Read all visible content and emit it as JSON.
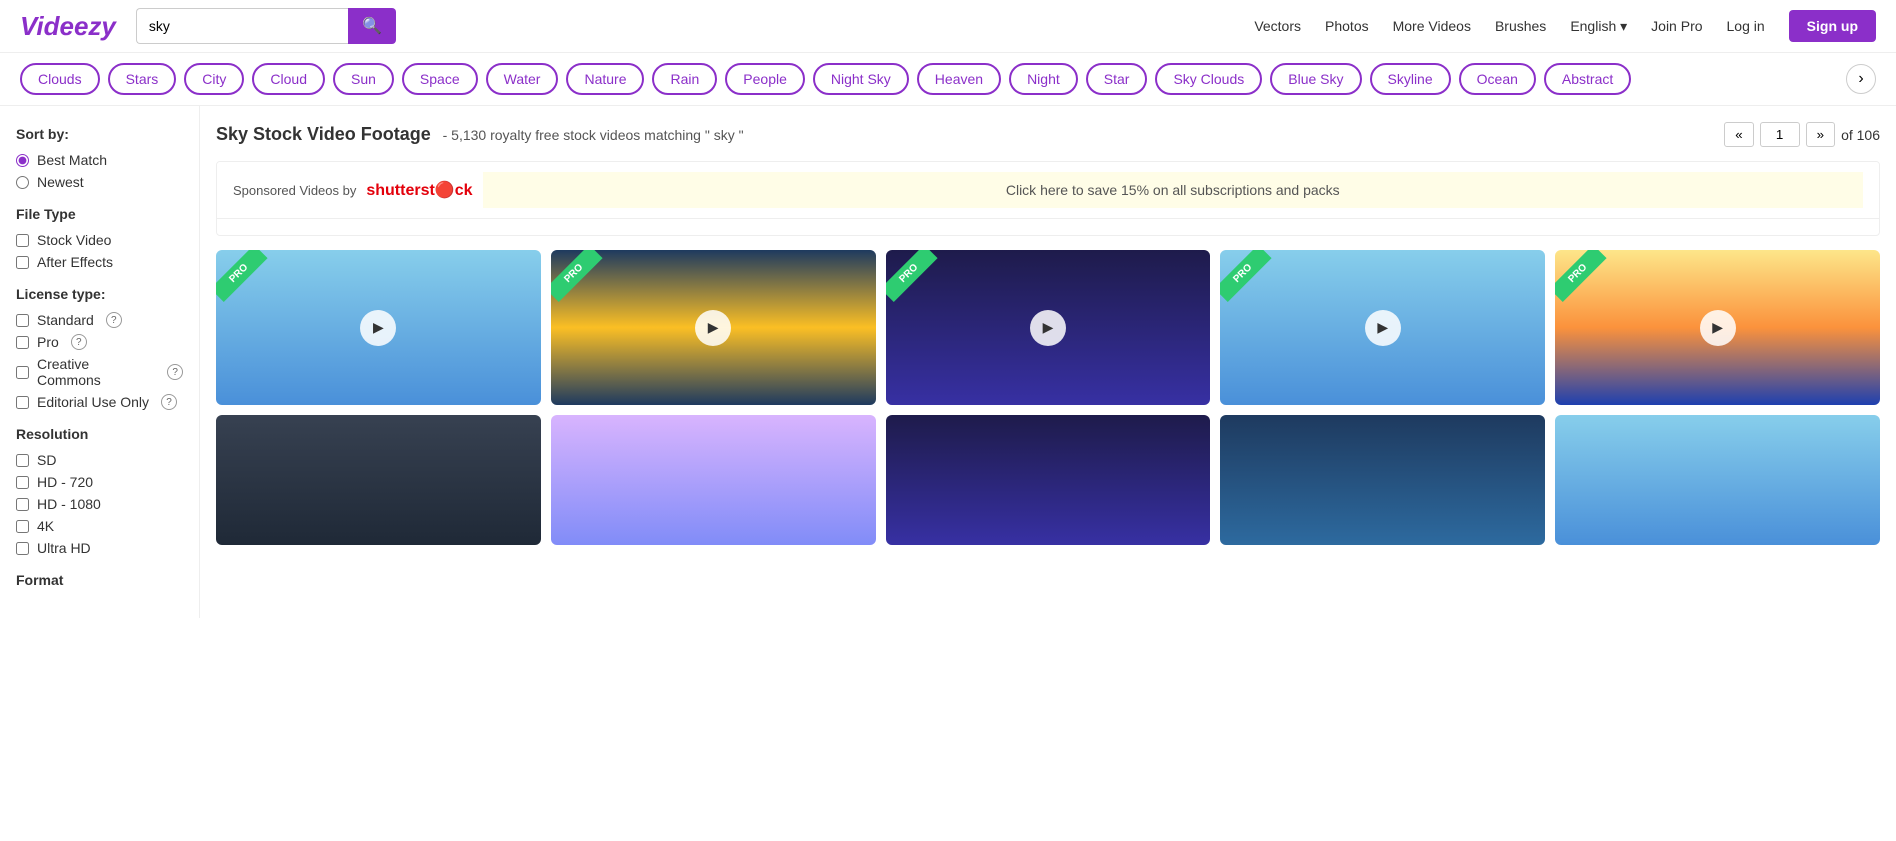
{
  "header": {
    "logo": "Videezy",
    "search": {
      "value": "sky",
      "placeholder": "sky"
    },
    "nav": {
      "vectors": "Vectors",
      "photos": "Photos",
      "more_videos": "More Videos",
      "brushes": "Brushes",
      "language": "English",
      "join_pro": "Join Pro",
      "log_in": "Log in",
      "sign_up": "Sign up"
    }
  },
  "tags": [
    "Clouds",
    "Stars",
    "City",
    "Cloud",
    "Sun",
    "Space",
    "Water",
    "Nature",
    "Rain",
    "People",
    "Night Sky",
    "Heaven",
    "Night",
    "Star",
    "Sky Clouds",
    "Blue Sky",
    "Skyline",
    "Ocean",
    "Abstract"
  ],
  "sort": {
    "label": "Sort by:",
    "options": [
      "Best Match",
      "Newest"
    ]
  },
  "filters": {
    "file_type": {
      "title": "File Type",
      "options": [
        "Stock Video",
        "After Effects"
      ]
    },
    "license": {
      "title": "License type:",
      "options": [
        {
          "label": "Standard",
          "help": true
        },
        {
          "label": "Pro",
          "help": true
        },
        {
          "label": "Creative Commons",
          "help": true
        },
        {
          "label": "Editorial Use Only",
          "help": true
        }
      ]
    },
    "resolution": {
      "title": "Resolution",
      "options": [
        "SD",
        "HD - 720",
        "HD - 1080",
        "4K",
        "Ultra HD"
      ]
    },
    "format": {
      "title": "Format"
    }
  },
  "results": {
    "title": "Sky Stock Video Footage",
    "count_text": "- 5,130 royalty free stock videos matching",
    "query": "\" sky \"",
    "page": "1",
    "total_pages": "of 106"
  },
  "sponsored": {
    "text": "Sponsored Videos by",
    "brand": "shutterstock",
    "promo": "Click here to save 15% on all subscriptions and packs"
  },
  "thumbs_row1": [
    {
      "style": "sky-blue"
    },
    {
      "style": "sky-cloud"
    },
    {
      "style": "sky-blue"
    },
    {
      "style": "sky-dusk"
    },
    {
      "style": "sky-blue"
    },
    {
      "style": "sky-blue"
    },
    {
      "style": "sky-cloud"
    }
  ],
  "thumbs_row2": [
    {
      "style": "sky-dusk"
    },
    {
      "style": "sky-blue"
    },
    {
      "style": "sky-pink"
    },
    {
      "style": "sky-lavender"
    },
    {
      "style": "sky-cloud"
    },
    {
      "style": "sky-cloud"
    },
    {
      "style": "sky-bright"
    }
  ],
  "main_videos": [
    {
      "style": "sky-blue",
      "pro": true
    },
    {
      "style": "sky-bridge",
      "pro": true
    },
    {
      "style": "sky-night",
      "pro": true
    },
    {
      "style": "sky-blue",
      "pro": true
    },
    {
      "style": "sky-morning",
      "pro": true
    }
  ],
  "bottom_videos": [
    {
      "style": "sky-city"
    },
    {
      "style": "sky-lavender"
    },
    {
      "style": "sky-night"
    },
    {
      "style": "sky-deep"
    },
    {
      "style": "sky-blue"
    }
  ]
}
